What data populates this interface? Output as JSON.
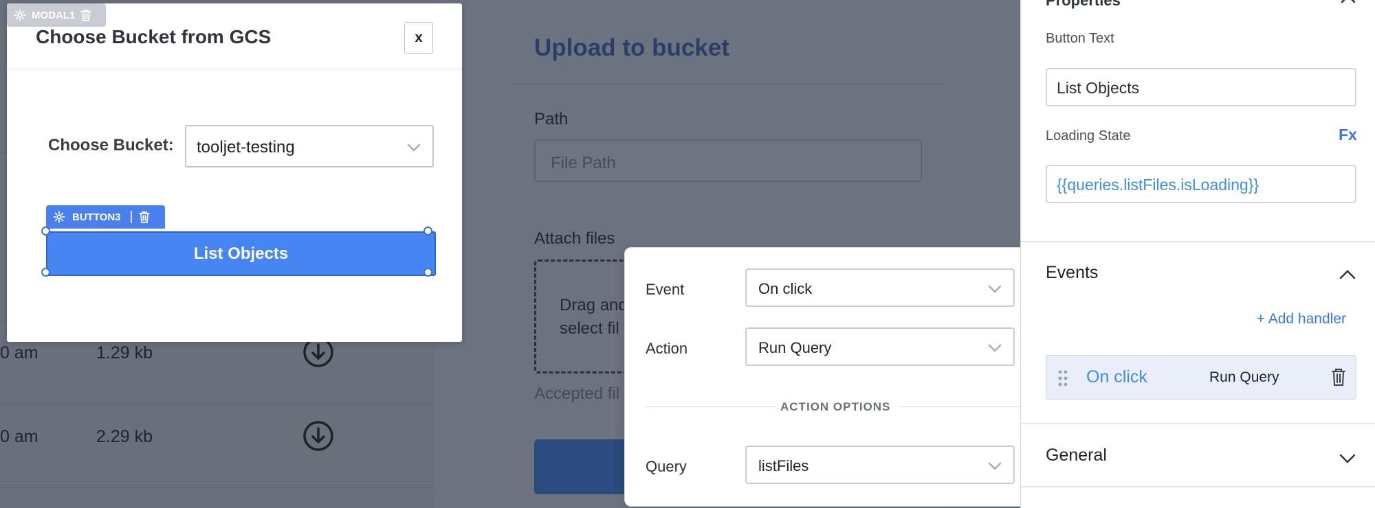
{
  "background": {
    "table_rows": [
      {
        "time": "0 am",
        "size": "1.29 kb"
      },
      {
        "time": "0 am",
        "size": "2.29 kb"
      }
    ],
    "upload": {
      "title": "Upload to bucket",
      "path_label": "Path",
      "path_placeholder": "File Path",
      "attach_label": "Attach files",
      "drop_text_line1": "Drag and",
      "drop_text_line2": "select fil",
      "accepted_text": "Accepted fil"
    }
  },
  "modal": {
    "tag_label": "MODAL1",
    "title": "Choose Bucket from GCS",
    "close_label": "x",
    "choose_label": "Choose Bucket:",
    "bucket_value": "tooljet-testing",
    "button_tag_label": "BUTTON3",
    "button_label": "List Objects"
  },
  "popover": {
    "event_label": "Event",
    "event_value": "On click",
    "action_label": "Action",
    "action_value": "Run Query",
    "options_title": "ACTION OPTIONS",
    "query_label": "Query",
    "query_value": "listFiles"
  },
  "panel": {
    "properties_title": "Properties",
    "button_text_label": "Button Text",
    "button_text_value": "List Objects",
    "loading_state_label": "Loading State",
    "fx_label": "Fx",
    "loading_state_value": "{{queries.listFiles.isLoading}}",
    "events_title": "Events",
    "add_handler_label": "+ Add handler",
    "handler_event": "On click",
    "handler_action": "Run Query",
    "general_title": "General"
  },
  "colors": {
    "accent": "#4786f2",
    "link": "#3b74e6",
    "overlay": "#6b7280"
  }
}
